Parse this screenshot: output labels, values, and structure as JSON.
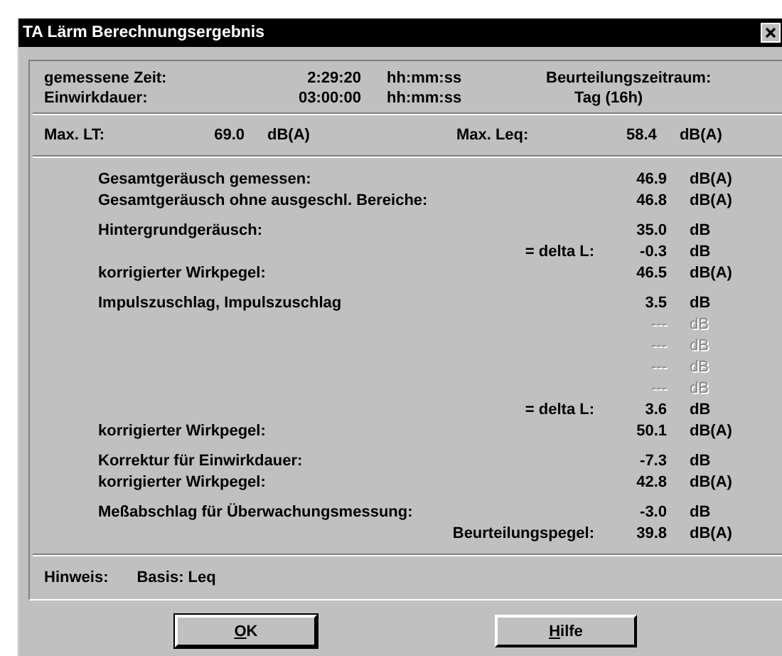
{
  "window": {
    "title": "TA Lärm Berechnungsergebnis"
  },
  "info": {
    "rows": [
      {
        "label": "gemessene Zeit:",
        "value": "2:29:20",
        "unit": "hh:mm:ss",
        "extra": "Beurteilungszeitraum:"
      },
      {
        "label": "Einwirkdauer:",
        "value": "03:00:00",
        "unit": "hh:mm:ss",
        "extra": "Tag (16h)"
      }
    ]
  },
  "maxima": [
    {
      "label": "Max. LT:",
      "value": "69.0",
      "unit": "dB(A)"
    },
    {
      "label": "Max. Leq:",
      "value": "58.4",
      "unit": "dB(A)"
    }
  ],
  "results": [
    [
      {
        "label": "Gesamtgeräusch gemessen:",
        "value": "46.9",
        "unit": "dB(A)",
        "disabled": false
      },
      {
        "label": "Gesamtgeräusch ohne ausgeschl. Bereiche:",
        "value": "46.8",
        "unit": "dB(A)",
        "disabled": false
      }
    ],
    [
      {
        "label": "Hintergrundgeräusch:",
        "value": "35.0",
        "unit": "dB",
        "disabled": false
      },
      {
        "note": "= delta L:",
        "value": "-0.3",
        "unit": "dB",
        "disabled": false
      },
      {
        "label": "korrigierter Wirkpegel:",
        "value": "46.5",
        "unit": "dB(A)",
        "disabled": false
      }
    ],
    [
      {
        "label": "Impulszuschlag, Impulszuschlag",
        "value": "3.5",
        "unit": "dB",
        "disabled": false
      },
      {
        "value": "---",
        "unit": "dB",
        "disabled": true
      },
      {
        "value": "---",
        "unit": "dB",
        "disabled": true
      },
      {
        "value": "---",
        "unit": "dB",
        "disabled": true
      },
      {
        "value": "---",
        "unit": "dB",
        "disabled": true
      },
      {
        "note": "= delta L:",
        "value": "3.6",
        "unit": "dB",
        "disabled": false
      },
      {
        "label": "korrigierter Wirkpegel:",
        "value": "50.1",
        "unit": "dB(A)",
        "disabled": false
      }
    ],
    [
      {
        "label": "Korrektur für Einwirkdauer:",
        "value": "-7.3",
        "unit": "dB",
        "disabled": false
      },
      {
        "label": "korrigierter Wirkpegel:",
        "value": "42.8",
        "unit": "dB(A)",
        "disabled": false
      }
    ],
    [
      {
        "label": "Meßabschlag für Überwachungsmessung:",
        "value": "-3.0",
        "unit": "dB",
        "disabled": false
      },
      {
        "note": "Beurteilungspegel:",
        "value": "39.8",
        "unit": "dB(A)",
        "disabled": false
      }
    ]
  ],
  "hint": {
    "label": "Hinweis:",
    "value": "Basis: Leq"
  },
  "buttons": [
    {
      "label": "OK",
      "default": true
    },
    {
      "label": "Hilfe",
      "default": false
    }
  ]
}
